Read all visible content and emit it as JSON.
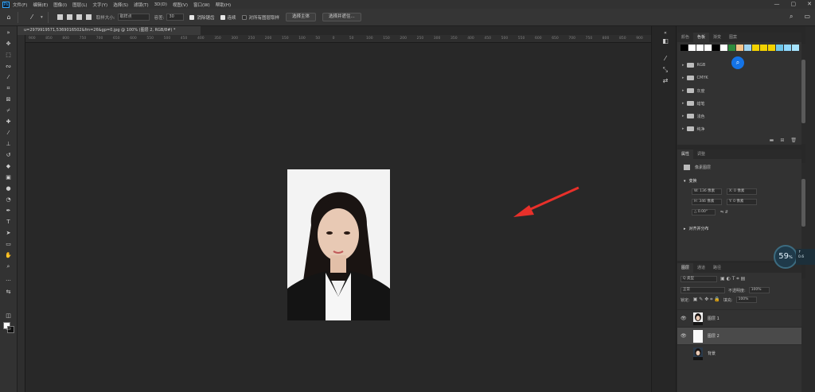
{
  "app": {
    "logo_text": "Ps",
    "menu": [
      "文件(F)",
      "编辑(E)",
      "图像(I)",
      "图层(L)",
      "文字(Y)",
      "选择(S)",
      "滤镜(T)",
      "3D(D)",
      "视图(V)",
      "窗口(W)",
      "帮助(H)"
    ],
    "window_controls": [
      "—",
      "▢",
      "✕"
    ]
  },
  "options_bar": {
    "sample_size_label": "取样大小:",
    "sample_size_value": "取样点",
    "tolerance_label": "容差:",
    "tolerance_value": "30",
    "antialias_label": "消除锯齿",
    "contiguous_label": "连续",
    "all_layers_label": "对所有图层取样",
    "select_subject": "选择主体",
    "select_and_mask": "选择并遮住..."
  },
  "document": {
    "tab_title": "u=2979919571,5369016502&fm=26&gp=0.jpg @ 100% (图层 2, RGB/8#) *",
    "ruler_ticks": [
      "900",
      "850",
      "800",
      "750",
      "700",
      "650",
      "600",
      "550",
      "500",
      "450",
      "400",
      "350",
      "300",
      "250",
      "200",
      "150",
      "100",
      "50",
      "0",
      "50",
      "100",
      "150",
      "200",
      "250",
      "300",
      "350",
      "400",
      "450",
      "500",
      "550",
      "600",
      "650",
      "700",
      "750",
      "800",
      "850",
      "900"
    ]
  },
  "swatches_panel": {
    "tabs": [
      "颜色",
      "色板",
      "渐变",
      "图案"
    ],
    "active_tab": 1,
    "swatch_colors": [
      "#000000",
      "#ffffff",
      "#ffffff",
      "#ffffff",
      "#000000",
      "#ffffff",
      "#2e8b3d",
      "#f6c48a",
      "#9ed2ef",
      "#f2d200",
      "#f2d200",
      "#f2d200",
      "#6ec6ea",
      "#8fd9ff",
      "#a6e4ff"
    ],
    "folders": [
      "RGB",
      "CMYK",
      "灰度",
      "蜡笔",
      "浅色",
      "纯净"
    ]
  },
  "properties_panel": {
    "tabs": [
      "属性",
      "调整"
    ],
    "layer_type": "像素图层",
    "transform_title": "变换",
    "width": "W: 136 像素",
    "height": "H: 346 像素",
    "x": "X: 0 像素",
    "y": "Y: 0 像素",
    "angle": "△ 0.00°",
    "align_title": "对齐并分布"
  },
  "layers_panel": {
    "tabs": [
      "图层",
      "通道",
      "路径"
    ],
    "filter_label": "Q 类型",
    "blend_mode": "正常",
    "opacity_label": "不透明度:",
    "opacity_value": "100%",
    "lock_label": "锁定:",
    "fill_label": "填充:",
    "fill_value": "100%",
    "layers": [
      {
        "name": "图层 1",
        "visible": true,
        "selected": false,
        "thumb": "photo"
      },
      {
        "name": "图层 2",
        "visible": true,
        "selected": true,
        "thumb": "white"
      },
      {
        "name": "背景",
        "visible": false,
        "selected": false,
        "thumb": "photo"
      }
    ]
  },
  "overlay": {
    "fps": "59",
    "fps_suffix": "%",
    "fps_tail_1": "↑",
    "fps_tail_2": "0.6"
  }
}
